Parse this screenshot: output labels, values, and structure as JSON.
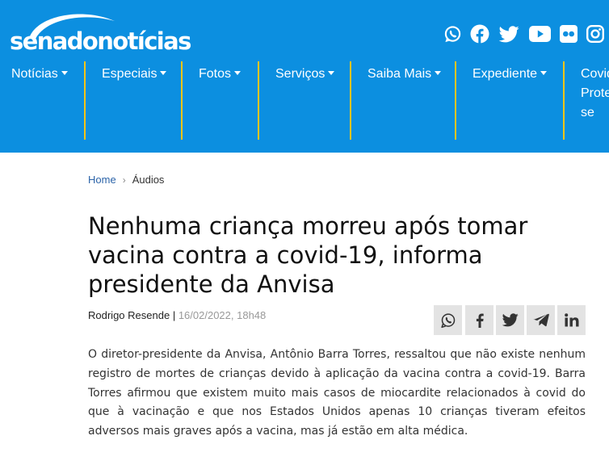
{
  "header": {
    "logo_text": "senadonotícias",
    "social_icons": [
      "whatsapp-icon",
      "facebook-icon",
      "twitter-icon",
      "youtube-icon",
      "flickr-icon",
      "instagram-icon"
    ],
    "brand_color": "#0c8fe0",
    "separator_color": "#f5c518"
  },
  "nav": {
    "items": [
      {
        "label": "Notícias"
      },
      {
        "label": "Especiais"
      },
      {
        "label": "Fotos"
      },
      {
        "label": "Serviços"
      },
      {
        "label": "Saiba Mais"
      },
      {
        "label": "Expediente"
      }
    ],
    "partial_item_lines": [
      "Covid",
      "Prote",
      "se"
    ]
  },
  "breadcrumb": {
    "home": "Home",
    "separator": "›",
    "current": "Áudios"
  },
  "article": {
    "title": "Nenhuma criança morreu após tomar vacina contra a covid-19, informa presidente da Anvisa",
    "author": "Rodrigo Resende",
    "byline_separator": "|",
    "date": "16/02/2022, 18h48",
    "body": "O diretor-presidente da Anvisa, Antônio Barra Torres, ressaltou que não existe nenhum registro de mortes de crianças devido à aplicação da vacina contra a covid-19. Barra Torres afirmou que existem muito mais casos de miocardite relacionados à covid do que à vacinação e que nos Estados Unidos apenas 10 crianças tiveram efeitos adversos mais graves após a vacina, mas já estão em alta médica."
  },
  "share": {
    "icons": [
      "whatsapp-icon",
      "facebook-icon",
      "twitter-icon",
      "telegram-icon",
      "linkedin-icon"
    ],
    "button_bg": "#e3e3e3"
  }
}
